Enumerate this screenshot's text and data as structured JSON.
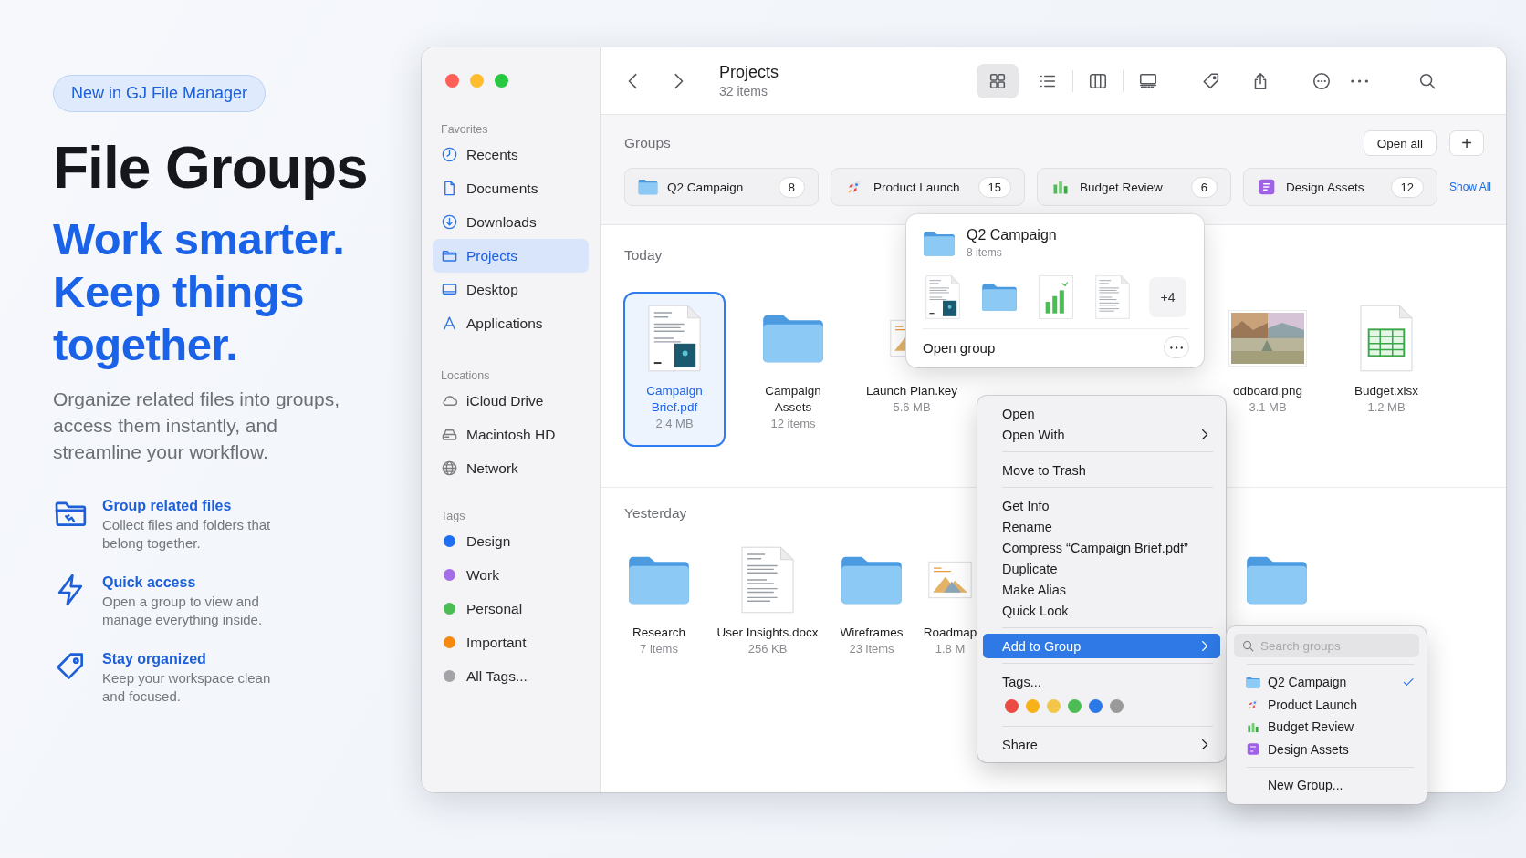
{
  "badge": "New in GJ File Manager",
  "title": "File Groups",
  "headline": "Work smarter. Keep things together.",
  "intro": "Organize related files into groups, access them instantly, and streamline your workflow.",
  "features": [
    {
      "title": "Group related files",
      "text": "Collect files and folders that belong together."
    },
    {
      "title": "Quick access",
      "text": "Open a group to view and manage everything inside."
    },
    {
      "title": "Stay organized",
      "text": "Keep your workspace clean and focused."
    }
  ],
  "sidebar": {
    "sections": [
      {
        "header": "Favorites",
        "items": [
          {
            "label": "Recents",
            "selected": false
          },
          {
            "label": "Documents",
            "selected": false
          },
          {
            "label": "Downloads",
            "selected": false
          },
          {
            "label": "Projects",
            "selected": true
          },
          {
            "label": "Desktop",
            "selected": false
          },
          {
            "label": "Applications",
            "selected": false
          }
        ]
      },
      {
        "header": "Locations",
        "items": [
          {
            "label": "iCloud Drive",
            "selected": false
          },
          {
            "label": "Macintosh HD",
            "selected": false
          },
          {
            "label": "Network",
            "selected": false
          }
        ]
      },
      {
        "header": "Tags",
        "items": [
          {
            "label": "Design",
            "color": "#1e6ff0",
            "selected": false
          },
          {
            "label": "Work",
            "color": "#a36ee6",
            "selected": false
          },
          {
            "label": "Personal",
            "color": "#4cbc55",
            "selected": false
          },
          {
            "label": "Important",
            "color": "#f58a12",
            "selected": false
          },
          {
            "label": "All Tags...",
            "color": "#a4a4a8",
            "selected": false
          }
        ]
      }
    ]
  },
  "toolbar": {
    "title": "Projects",
    "subtitle": "32 items",
    "view_modes": [
      {
        "selected": true
      },
      {
        "selected": false
      },
      {
        "selected": false
      },
      {
        "selected": false
      }
    ]
  },
  "groups": {
    "label": "Groups",
    "open_all": "Open all",
    "add": "+",
    "show_all": "Show All",
    "chips": [
      {
        "name": "Q2 Campaign",
        "count": "8"
      },
      {
        "name": "Product Launch",
        "count": "15"
      },
      {
        "name": "Budget Review",
        "count": "6"
      },
      {
        "name": "Design Assets",
        "count": "12"
      }
    ]
  },
  "sections": [
    {
      "label": "Today",
      "files": [
        {
          "name": "Campaign Brief.pdf",
          "meta": "2.4 MB",
          "kind": "pdf",
          "selected": true
        },
        {
          "name": "Campaign Assets",
          "meta": "12 items",
          "kind": "folder",
          "selected": false
        },
        {
          "name": "Launch Plan.key",
          "meta": "5.6 MB",
          "kind": "keynote",
          "selected": false
        },
        {
          "name": "odboard.png",
          "meta": "3.1 MB",
          "selected": false
        },
        {
          "name": "Budget.xlsx",
          "meta": "1.2 MB",
          "kind": "spreadsheet",
          "selected": false
        }
      ]
    },
    {
      "label": "Yesterday",
      "files": [
        {
          "name": "Research",
          "meta": "7 items",
          "kind": "folder",
          "selected": false
        },
        {
          "name": "User Insights.docx",
          "meta": "256 KB",
          "kind": "doc",
          "selected": false
        },
        {
          "name": "Wireframes",
          "meta": "23 items",
          "kind": "folder",
          "selected": false
        },
        {
          "name": "Roadmap",
          "meta": "1.8 M",
          "kind": "keynote",
          "selected": false
        },
        {
          "kind": "folder",
          "selected": false
        }
      ]
    }
  ],
  "popover": {
    "title": "Q2 Campaign",
    "subtitle": "8 items",
    "thumbs": [
      {
        "kind": "pdf"
      },
      {
        "kind": "folder"
      },
      {
        "kind": "chart"
      },
      {
        "kind": "doc"
      }
    ],
    "more": "+4",
    "action": "Open group"
  },
  "context_menu": {
    "items": [
      {
        "kind": "item",
        "label": "Open",
        "submenu": false,
        "selected": false
      },
      {
        "kind": "item",
        "label": "Open With",
        "submenu": true,
        "selected": false
      },
      {
        "kind": "separator"
      },
      {
        "kind": "item",
        "label": "Move to Trash",
        "submenu": false,
        "selected": false
      },
      {
        "kind": "separator"
      },
      {
        "kind": "item",
        "label": "Get Info",
        "submenu": false,
        "selected": false
      },
      {
        "kind": "item",
        "label": "Rename",
        "submenu": false,
        "selected": false
      },
      {
        "kind": "item",
        "label": "Compress “Campaign Brief.pdf”",
        "submenu": false,
        "selected": false
      },
      {
        "kind": "item",
        "label": "Duplicate",
        "submenu": false,
        "selected": false
      },
      {
        "kind": "item",
        "label": "Make Alias",
        "submenu": false,
        "selected": false
      },
      {
        "kind": "item",
        "label": "Quick Look",
        "submenu": false,
        "selected": false
      },
      {
        "kind": "separator"
      },
      {
        "kind": "item",
        "label": "Add to Group",
        "submenu": true,
        "selected": true
      },
      {
        "kind": "separator"
      },
      {
        "kind": "item",
        "label": "Tags...",
        "submenu": false,
        "selected": false
      },
      {
        "kind": "tags",
        "tags": [
          {
            "color": "#ec4b44"
          },
          {
            "color": "#f6b21b"
          },
          {
            "color": "#f2c54b"
          },
          {
            "color": "#4cbc55"
          },
          {
            "color": "#2c78e6"
          },
          {
            "color": "#9a9a9a"
          }
        ]
      },
      {
        "kind": "separator"
      },
      {
        "kind": "item",
        "label": "Share",
        "submenu": true,
        "selected": false
      }
    ]
  },
  "submenu": {
    "placeholder": "Search groups",
    "groups": [
      {
        "name": "Q2 Campaign",
        "checked": true
      },
      {
        "name": "Product Launch",
        "checked": false
      },
      {
        "name": "Budget Review",
        "checked": false
      },
      {
        "name": "Design Assets",
        "checked": false
      }
    ],
    "new_group": "New Group..."
  }
}
